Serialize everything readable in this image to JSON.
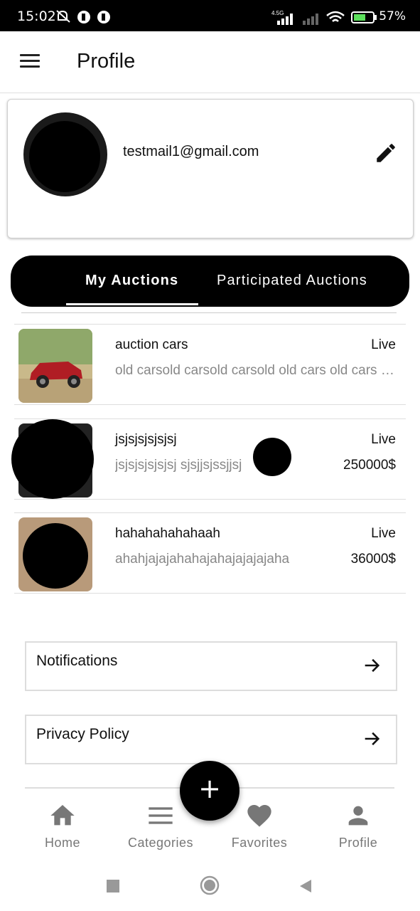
{
  "status_bar": {
    "time": "15:02",
    "network": "4.5G",
    "battery": "57%"
  },
  "app_bar": {
    "title": "Profile"
  },
  "profile": {
    "email": "testmail1@gmail.com"
  },
  "tabs": [
    {
      "label": "My Auctions",
      "selected": true
    },
    {
      "label": "Participated Auctions",
      "selected": false
    }
  ],
  "auctions": [
    {
      "name": "auction cars",
      "description": "old carsold carsold carsold old cars old cars old cars",
      "status": "Live",
      "price": ""
    },
    {
      "name": "jsjsjsjsjsjsj",
      "description": "jsjsjsjsjsjsj sjsjjsjssjjsj",
      "status": "Live",
      "price": "250000$"
    },
    {
      "name": "hahahahahahaah",
      "description": "ahahjajajahahajahajajajajaha",
      "status": "Live",
      "price": "36000$"
    }
  ],
  "settings": [
    {
      "label": "Notifications"
    },
    {
      "label": "Privacy Policy"
    }
  ],
  "fab": {
    "label": "+"
  },
  "bottom_nav": [
    {
      "label": "Home",
      "icon": "home-icon"
    },
    {
      "label": "Categories",
      "icon": "categories-icon"
    },
    {
      "label": "Favorites",
      "icon": "heart-icon"
    },
    {
      "label": "Profile",
      "icon": "person-icon"
    }
  ],
  "colors": {
    "primary": "#000000",
    "nav_inactive": "#777777",
    "secondary_text": "#888888"
  }
}
